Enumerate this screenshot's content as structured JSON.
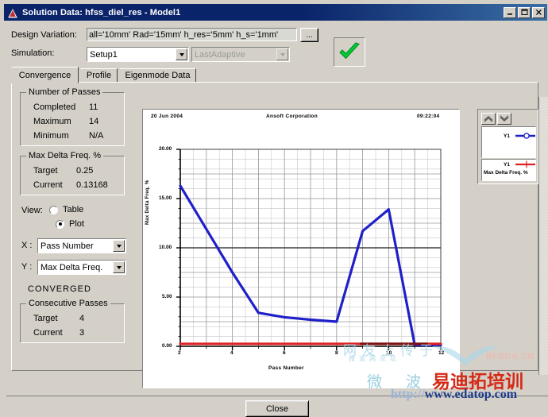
{
  "window": {
    "title": "Solution Data: hfss_diel_res - Model1",
    "app_icon": "ansoft-logo-icon",
    "buttons": {
      "minimize": "minimize-icon",
      "maximize": "maximize-icon",
      "close": "close-icon"
    }
  },
  "form": {
    "design_variation_label": "Design Variation:",
    "design_variation_value": "all='10mm' Rad='15mm' h_res='5mm' h_s='1mm'",
    "design_variation_browse": "...",
    "simulation_label": "Simulation:",
    "simulation_value": "Setup1",
    "solution_value": "LastAdaptive",
    "status_icon": "green-check-icon"
  },
  "tabs": [
    {
      "label": "Convergence",
      "active": true
    },
    {
      "label": "Profile",
      "active": false
    },
    {
      "label": "Eigenmode Data",
      "active": false
    }
  ],
  "panels": {
    "number_of_passes": {
      "title": "Number of Passes",
      "rows": [
        {
          "label": "Completed",
          "value": "11"
        },
        {
          "label": "Maximum",
          "value": "14"
        },
        {
          "label": "Minimum",
          "value": "N/A"
        }
      ]
    },
    "max_delta_freq": {
      "title": "Max Delta Freq. %",
      "rows": [
        {
          "label": "Target",
          "value": "0.25"
        },
        {
          "label": "Current",
          "value": "0.13168"
        }
      ]
    },
    "view": {
      "label": "View:",
      "options": [
        {
          "label": "Table",
          "selected": false
        },
        {
          "label": "Plot",
          "selected": true
        }
      ]
    },
    "axes": {
      "x_label": "X :",
      "x_value": "Pass Number",
      "y_label": "Y :",
      "y_value": "Max Delta Freq."
    },
    "converged_text": "CONVERGED",
    "consecutive_passes": {
      "title": "Consecutive Passes",
      "rows": [
        {
          "label": "Target",
          "value": "4"
        },
        {
          "label": "Current",
          "value": "3"
        }
      ]
    }
  },
  "legend": {
    "scroll_up_icon": "chevron-up-icon",
    "scroll_down_icon": "chevron-down-icon",
    "entries": [
      {
        "name": "Y1",
        "color": "#2020c8",
        "marker": "circle",
        "caption": ""
      },
      {
        "name": "Y1",
        "color": "#e02020",
        "marker": "tick",
        "caption": "Max Delta Freq. %"
      }
    ]
  },
  "footer": {
    "close_label": "Close"
  },
  "watermark": {
    "cn_top": "网友上传于",
    "cn_top_small": "微波网论坛",
    "brand": "RFEDA.CN",
    "cn_big": "微 波",
    "cn_logo": "易迪拓培训",
    "url_faint": "http://",
    "url": "www.edatop.com"
  },
  "chart_data": {
    "type": "line",
    "title": "Ansoft Corporation",
    "date": "20 Jun 2004",
    "time": "09:22:04",
    "xlabel": "Pass Number",
    "ylabel": "Max Delta Freq. %",
    "xlim": [
      2,
      12
    ],
    "ylim": [
      0,
      20
    ],
    "xticks": [
      "2",
      "4",
      "6",
      "8",
      "10",
      "12"
    ],
    "yticks": [
      "20.00",
      "15.00",
      "10.00",
      "5.00",
      "0.00"
    ],
    "grid": true,
    "legend_position": "right-outside",
    "series": [
      {
        "name": "Y1",
        "color": "#2020c8",
        "x": [
          2,
          3,
          4,
          5,
          6,
          7,
          8,
          9,
          10,
          11,
          12
        ],
        "y": [
          16.3,
          11.9,
          7.5,
          3.4,
          2.95,
          2.7,
          2.5,
          11.7,
          13.9,
          0.13,
          0.13
        ]
      },
      {
        "name": "Y1 target",
        "color": "#e02020",
        "x": [
          2,
          12
        ],
        "y": [
          0.25,
          0.25
        ]
      }
    ]
  }
}
